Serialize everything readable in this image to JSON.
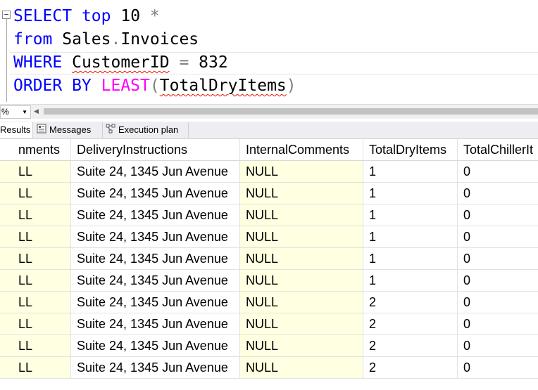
{
  "editor": {
    "line1": {
      "kw1": "SELECT",
      "kw2": "top",
      "num": "10",
      "star": "*"
    },
    "line2": {
      "kw": "from",
      "obj1": "Sales",
      "dot": ".",
      "obj2": "Invoices"
    },
    "line3": {
      "kw": "WHERE",
      "col": "CustomerID",
      "op": "=",
      "val": "832"
    },
    "line4": {
      "kw": "ORDER BY",
      "fn": "LEAST",
      "lp": "(",
      "arg": "TotalDryItems",
      "rp": ")"
    }
  },
  "zoom": {
    "value": "%",
    "arrow": "▼"
  },
  "tabs": [
    {
      "label": "Results",
      "active": true
    },
    {
      "label": "Messages",
      "active": false
    },
    {
      "label": "Execution plan",
      "active": false
    }
  ],
  "grid": {
    "columns": [
      "nments",
      "DeliveryInstructions",
      "InternalComments",
      "TotalDryItems",
      "TotalChillerIt"
    ],
    "rows": [
      [
        "LL",
        "Suite 24, 1345 Jun Avenue",
        "NULL",
        "1",
        "0"
      ],
      [
        "LL",
        "Suite 24, 1345 Jun Avenue",
        "NULL",
        "1",
        "0"
      ],
      [
        "LL",
        "Suite 24, 1345 Jun Avenue",
        "NULL",
        "1",
        "0"
      ],
      [
        "LL",
        "Suite 24, 1345 Jun Avenue",
        "NULL",
        "1",
        "0"
      ],
      [
        "LL",
        "Suite 24, 1345 Jun Avenue",
        "NULL",
        "1",
        "0"
      ],
      [
        "LL",
        "Suite 24, 1345 Jun Avenue",
        "NULL",
        "1",
        "0"
      ],
      [
        "LL",
        "Suite 24, 1345 Jun Avenue",
        "NULL",
        "2",
        "0"
      ],
      [
        "LL",
        "Suite 24, 1345 Jun Avenue",
        "NULL",
        "2",
        "0"
      ],
      [
        "LL",
        "Suite 24, 1345 Jun Avenue",
        "NULL",
        "2",
        "0"
      ],
      [
        "LL",
        "Suite 24, 1345 Jun Avenue",
        "NULL",
        "2",
        "0"
      ]
    ]
  },
  "colors": {
    "keyword": "#0000ff",
    "function": "#ff00ff",
    "operator": "#808080",
    "null_cell": "#ffffe1",
    "squiggle": "#e51400"
  },
  "icons": {
    "collapse": "minus-box-icon",
    "messages": "messages-icon",
    "plan": "execution-plan-icon"
  }
}
